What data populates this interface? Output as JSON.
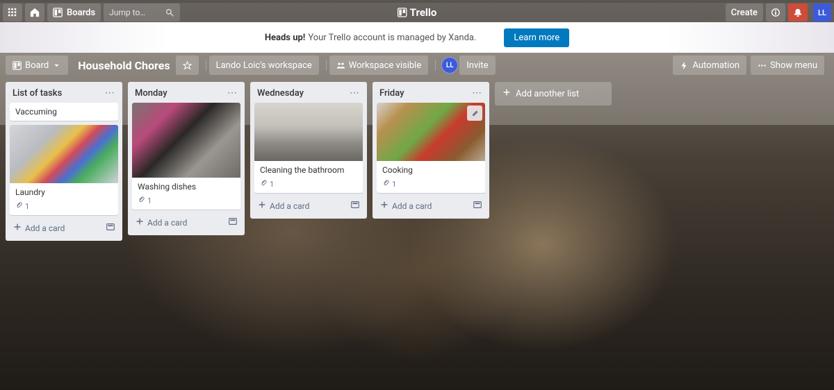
{
  "brand": "Trello",
  "nav": {
    "boards_label": "Boards",
    "search_placeholder": "Jump to…",
    "create_label": "Create",
    "avatar_initials": "LL"
  },
  "banner": {
    "headsup": "Heads up!",
    "message": "Your Trello account is managed by Xanda.",
    "learn_more": "Learn more"
  },
  "boardbar": {
    "board_btn": "Board",
    "title": "Household Chores",
    "workspace": "Lando Loic's workspace",
    "visibility": "Workspace visible",
    "member_initials": "LL",
    "invite": "Invite",
    "automation": "Automation",
    "show_menu": "Show menu"
  },
  "lists": [
    {
      "title": "List of tasks",
      "composer_text": "Vaccuming",
      "cards": [
        {
          "title": "Laundry",
          "attach": "1",
          "cover": "cover-laundry",
          "cover_tall": false
        }
      ],
      "add_label": "Add a card"
    },
    {
      "title": "Monday",
      "cards": [
        {
          "title": "Washing dishes",
          "attach": "1",
          "cover": "cover-dishes",
          "cover_tall": true
        }
      ],
      "add_label": "Add a card"
    },
    {
      "title": "Wednesday",
      "cards": [
        {
          "title": "Cleaning the bathroom",
          "attach": "1",
          "cover": "cover-bath",
          "cover_tall": false
        }
      ],
      "add_label": "Add a card"
    },
    {
      "title": "Friday",
      "cards": [
        {
          "title": "Cooking",
          "attach": "1",
          "cover": "cover-cook",
          "cover_tall": false,
          "edit_hover": true
        }
      ],
      "add_label": "Add a card"
    }
  ],
  "add_list_label": "Add another list"
}
